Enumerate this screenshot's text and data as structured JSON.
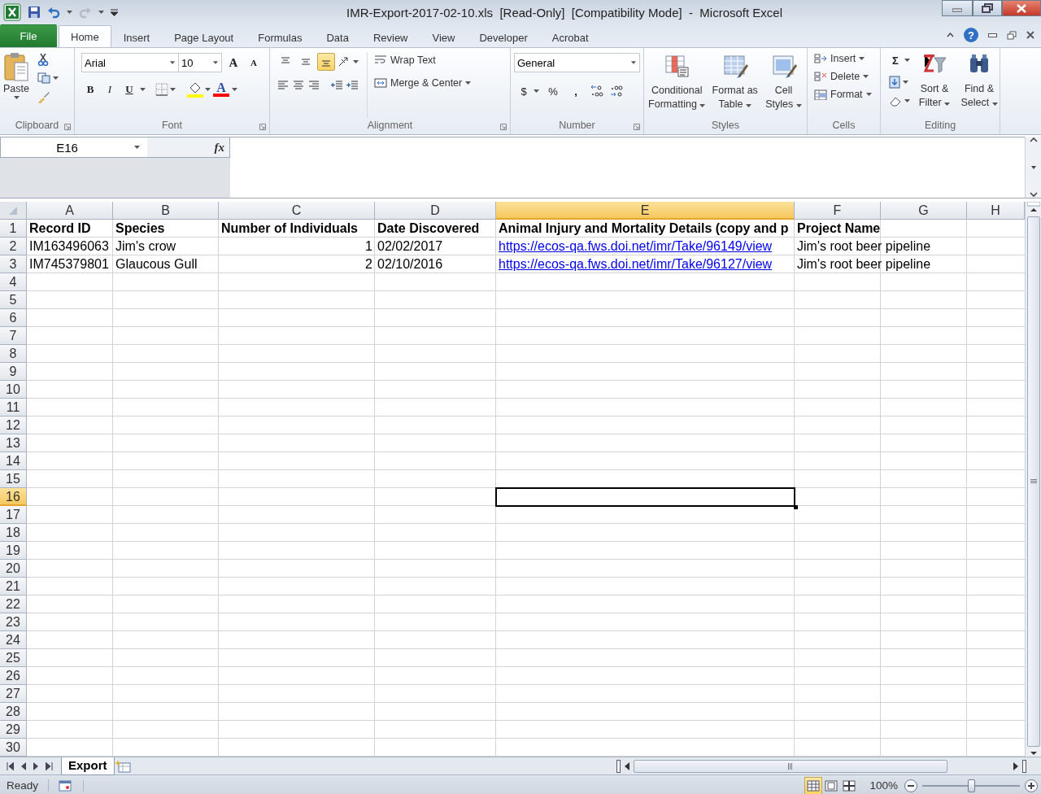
{
  "window": {
    "title": "IMR-Export-2017-02-10.xls  [Read-Only]  [Compatibility Mode]  -  Microsoft Excel"
  },
  "ribbon_tabs": [
    {
      "label": "File",
      "kind": "file",
      "selected": false
    },
    {
      "label": "Home",
      "kind": "tab",
      "selected": true
    },
    {
      "label": "Insert",
      "kind": "tab",
      "selected": false
    },
    {
      "label": "Page Layout",
      "kind": "tab",
      "selected": false
    },
    {
      "label": "Formulas",
      "kind": "tab",
      "selected": false
    },
    {
      "label": "Data",
      "kind": "tab",
      "selected": false
    },
    {
      "label": "Review",
      "kind": "tab",
      "selected": false
    },
    {
      "label": "View",
      "kind": "tab",
      "selected": false
    },
    {
      "label": "Developer",
      "kind": "tab",
      "selected": false
    },
    {
      "label": "Acrobat",
      "kind": "tab",
      "selected": false
    }
  ],
  "help_button": "?",
  "clipboard": {
    "paste": "Paste",
    "group": "Clipboard"
  },
  "font": {
    "name": "Arial",
    "size": "10",
    "grow": "A",
    "shrink": "A",
    "styles": [
      "B",
      "I",
      "U"
    ],
    "color_letter": "A",
    "group": "Font"
  },
  "alignment": {
    "vertical": [
      {
        "selected": false
      },
      {
        "selected": false
      },
      {
        "selected": true
      }
    ],
    "wrap": "Wrap Text",
    "merge": "Merge & Center",
    "group": "Alignment"
  },
  "number": {
    "format": "General",
    "currency": "$",
    "percent": "%",
    "comma": ",",
    "group": "Number"
  },
  "styles": {
    "buttons": [
      "Conditional Formatting",
      "Format as Table",
      "Cell Styles"
    ],
    "group": "Styles"
  },
  "cells": {
    "buttons": [
      "Insert",
      "Delete",
      "Format"
    ],
    "group": "Cells"
  },
  "editing": {
    "sum": "Σ",
    "buttons": [
      "Sort & Filter",
      "Find & Select"
    ],
    "group": "Editing"
  },
  "formula_bar": {
    "name_box": "E16",
    "function_label": "fx"
  },
  "sheet": {
    "columns": [
      {
        "label": "A",
        "selected": false
      },
      {
        "label": "B",
        "selected": false
      },
      {
        "label": "C",
        "selected": false
      },
      {
        "label": "D",
        "selected": false
      },
      {
        "label": "E",
        "selected": true
      },
      {
        "label": "F",
        "selected": false
      },
      {
        "label": "G",
        "selected": false
      },
      {
        "label": "H",
        "selected": false
      }
    ],
    "rows": [
      {
        "number": "1",
        "selected": false,
        "bold": true,
        "cells": [
          {
            "text": "Record ID",
            "kind": "text"
          },
          {
            "text": "Species",
            "kind": "text"
          },
          {
            "text": "Number of Individuals",
            "kind": "text"
          },
          {
            "text": "Date Discovered",
            "kind": "text"
          },
          {
            "text": "Animal Injury and Mortality Details (copy and p",
            "kind": "text"
          },
          {
            "text": "Project Name",
            "kind": "text"
          }
        ]
      },
      {
        "number": "2",
        "selected": false,
        "bold": false,
        "cells": [
          {
            "text": "IM163496063",
            "kind": "text"
          },
          {
            "text": "Jim's crow",
            "kind": "text"
          },
          {
            "text": "1",
            "kind": "number"
          },
          {
            "text": "02/02/2017",
            "kind": "text"
          },
          {
            "text": "https://ecos-qa.fws.doi.net/imr/Take/96149/view",
            "kind": "link"
          },
          {
            "text": "Jim's root beer pipeline",
            "kind": "text"
          }
        ]
      },
      {
        "number": "3",
        "selected": false,
        "bold": false,
        "cells": [
          {
            "text": "IM745379801",
            "kind": "text"
          },
          {
            "text": "Glaucous Gull",
            "kind": "text"
          },
          {
            "text": "2",
            "kind": "number"
          },
          {
            "text": "02/10/2016",
            "kind": "text"
          },
          {
            "text": "https://ecos-qa.fws.doi.net/imr/Take/96127/view",
            "kind": "link"
          },
          {
            "text": "Jim's root beer pipeline",
            "kind": "text"
          }
        ]
      },
      {
        "number": "4",
        "selected": false
      },
      {
        "number": "5",
        "selected": false
      },
      {
        "number": "6",
        "selected": false
      },
      {
        "number": "7",
        "selected": false
      },
      {
        "number": "8",
        "selected": false
      },
      {
        "number": "9",
        "selected": false
      },
      {
        "number": "10",
        "selected": false
      },
      {
        "number": "11",
        "selected": false
      },
      {
        "number": "12",
        "selected": false
      },
      {
        "number": "13",
        "selected": false
      },
      {
        "number": "14",
        "selected": false
      },
      {
        "number": "15",
        "selected": false
      },
      {
        "number": "16",
        "selected": true
      },
      {
        "number": "17",
        "selected": false
      },
      {
        "number": "18",
        "selected": false
      },
      {
        "number": "19",
        "selected": false
      },
      {
        "number": "20",
        "selected": false
      },
      {
        "number": "21",
        "selected": false
      },
      {
        "number": "22",
        "selected": false
      },
      {
        "number": "23",
        "selected": false
      },
      {
        "number": "24",
        "selected": false
      },
      {
        "number": "25",
        "selected": false
      },
      {
        "number": "26",
        "selected": false
      },
      {
        "number": "27",
        "selected": false
      },
      {
        "number": "28",
        "selected": false
      },
      {
        "number": "29",
        "selected": false
      },
      {
        "number": "30",
        "selected": false
      }
    ]
  },
  "sheet_tabs": [
    {
      "label": "Export",
      "selected": true
    }
  ],
  "status_bar": {
    "mode": "Ready",
    "views": [
      {
        "selected": true
      },
      {
        "selected": false
      },
      {
        "selected": false
      }
    ],
    "zoom": "100%",
    "zoom_slider": {
      "level": 0.5
    }
  }
}
